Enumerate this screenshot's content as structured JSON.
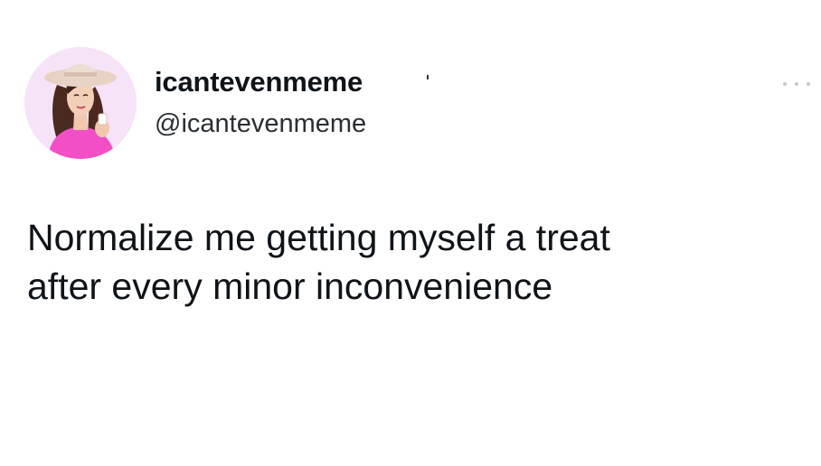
{
  "tweet": {
    "author": {
      "display_name": "icantevenmeme",
      "handle": "@icantevenmeme",
      "avatar": "avatar-illustration-woman-hat"
    },
    "more_icon": "more-horizontal-icon",
    "text": "Normalize me getting myself a treat\nafter every minor inconvenience"
  },
  "colors": {
    "background": "#ffffff",
    "text": "#0f1419",
    "avatar_bg": "#f7e3f7",
    "avatar_shirt": "#f24fc6",
    "avatar_hat": "#e8d2c6"
  }
}
